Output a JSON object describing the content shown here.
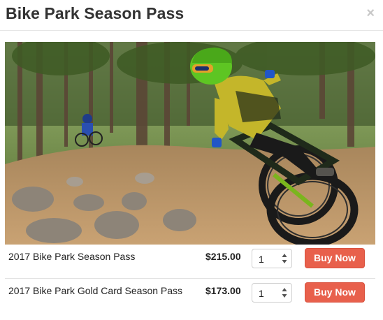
{
  "modal": {
    "title": "Bike Park Season Pass",
    "close_label": "×"
  },
  "hero_image": {
    "description_icon": "mountain-biker-photo"
  },
  "products": [
    {
      "name": "2017 Bike Park Season Pass",
      "price": "$215.00",
      "quantity": "1",
      "button_label": "Buy Now"
    },
    {
      "name": "2017 Bike Park Gold Card Season Pass",
      "price": "$173.00",
      "quantity": "1",
      "button_label": "Buy Now"
    }
  ],
  "colors": {
    "buy_button": "#e8604c",
    "title_text": "#333333"
  }
}
